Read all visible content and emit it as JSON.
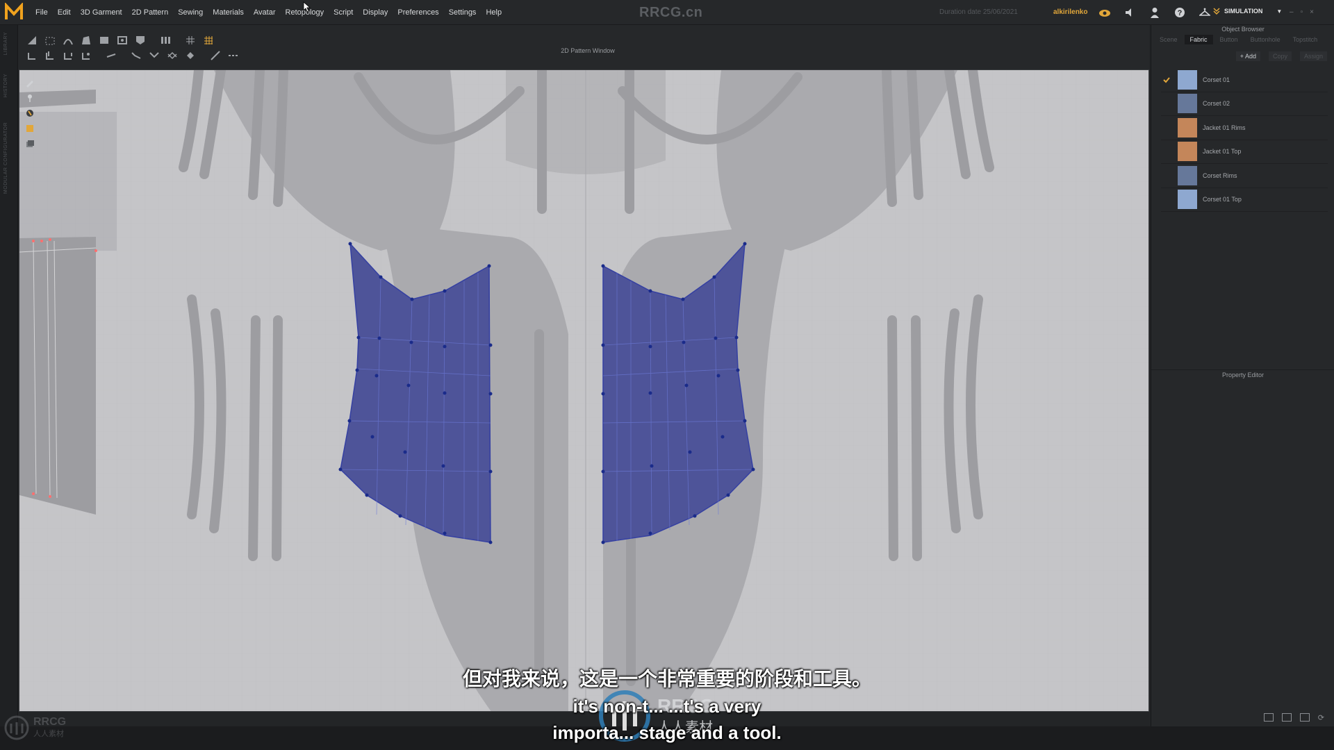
{
  "menubar": {
    "items": [
      "File",
      "Edit",
      "3D Garment",
      "2D Pattern",
      "Sewing",
      "Materials",
      "Avatar",
      "Retopology",
      "Script",
      "Display",
      "Preferences",
      "Settings",
      "Help"
    ],
    "center_brand": "RRCG.cn",
    "status_text": "Duration date 25/06/2021",
    "user_label": "alkirilenko",
    "mode": "SIMULATION",
    "window_controls": [
      "–",
      "▫",
      "×"
    ]
  },
  "left_strip": {
    "tabs": [
      "LIBRARY",
      "HISTORY",
      "MODULAR CONFIGURATOR"
    ]
  },
  "pattern_window": {
    "title": "2D Pattern Window"
  },
  "object_browser": {
    "title": "Object Browser",
    "tabs": [
      "Scene",
      "Fabric",
      "Button",
      "Buttonhole",
      "Topstitch"
    ],
    "active_tab": "Fabric",
    "actions": {
      "add": "+ Add",
      "copy": "Copy",
      "assign": "Assign"
    },
    "fabrics": [
      {
        "name": "Corset 01",
        "color": "#8ea8d0",
        "checked": true
      },
      {
        "name": "Corset 02",
        "color": "#66789a",
        "checked": false
      },
      {
        "name": "Jacket 01 Rims",
        "color": "#c4865a",
        "checked": false
      },
      {
        "name": "Jacket 01 Top",
        "color": "#c4865a",
        "checked": false
      },
      {
        "name": "Corset Rims",
        "color": "#66789a",
        "checked": false
      },
      {
        "name": "Corset 01 Top",
        "color": "#8ea8d0",
        "checked": false
      }
    ]
  },
  "property_editor": {
    "title": "Property Editor"
  },
  "subtitles": {
    "chinese": "但对我来说，这是一个非常重要的阶段和工具。",
    "english_line1": "it's non-t... ...t's a very",
    "english_line2": "importa... stage and a tool."
  },
  "overlay": {
    "brand": "RRCG",
    "brand_sub": "人人素材",
    "corner_brand": "RRCG",
    "corner_sub": "人人素材"
  },
  "colors": {
    "pattern_fill": "#4e5499",
    "pattern_point": "#1a2b8a",
    "canvas_bg": "#c2c2c5",
    "accent_user": "#e2a73a"
  }
}
